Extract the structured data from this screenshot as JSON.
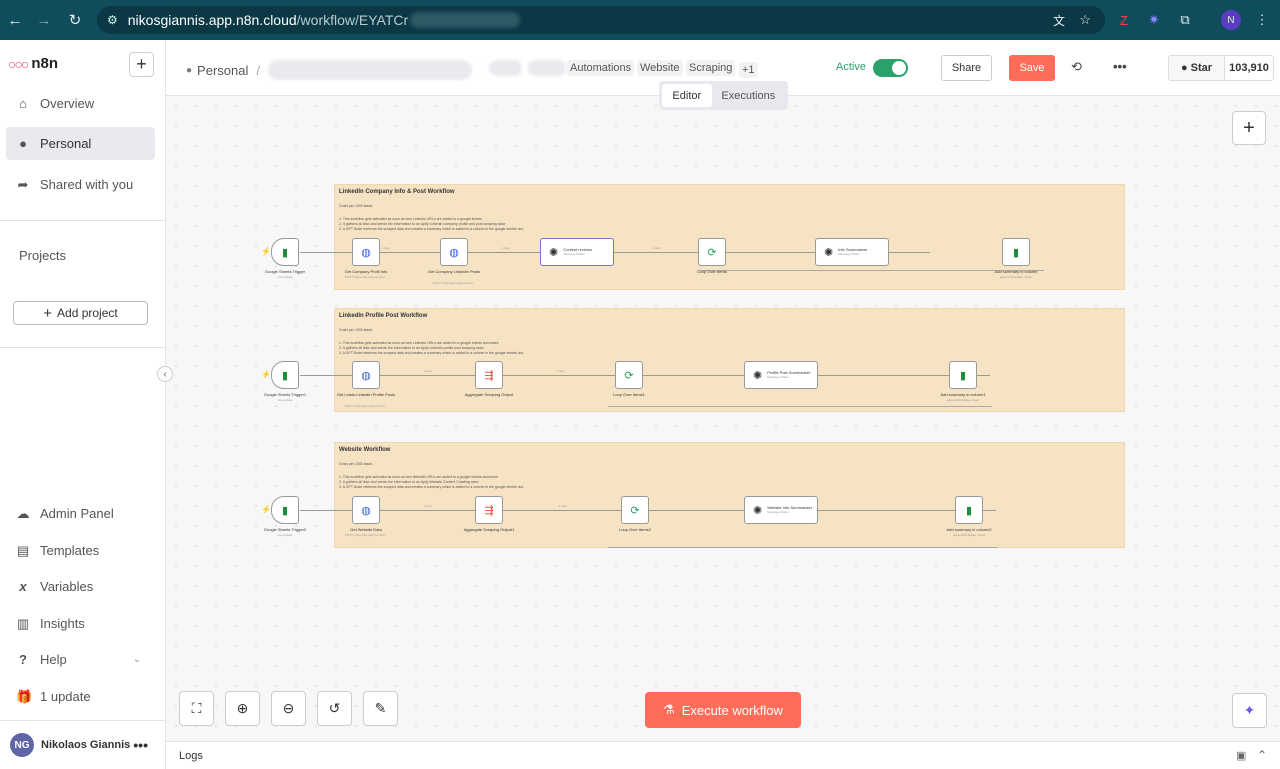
{
  "browser": {
    "url_host": "nikosgiannis.app.n8n.cloud",
    "url_path": "/workflow/EYATCr",
    "profile_initial": "N"
  },
  "sidebar": {
    "brand": "n8n",
    "items": [
      {
        "label": "Overview",
        "icon": "home-icon"
      },
      {
        "label": "Personal",
        "icon": "user-icon"
      },
      {
        "label": "Shared with you",
        "icon": "share-icon"
      }
    ],
    "projects_label": "Projects",
    "add_project": "Add project",
    "bottom_items": [
      {
        "label": "Admin Panel",
        "icon": "cloud-icon"
      },
      {
        "label": "Templates",
        "icon": "templates-icon"
      },
      {
        "label": "Variables",
        "icon": "variables-icon"
      },
      {
        "label": "Insights",
        "icon": "insights-icon"
      },
      {
        "label": "Help",
        "icon": "help-icon"
      },
      {
        "label": "1 update",
        "icon": "gift-icon"
      }
    ],
    "user": {
      "initials": "NG",
      "name": "Nikolaos Giannis"
    }
  },
  "header": {
    "breadcrumb": "Personal",
    "tags": [
      "Automations",
      "Website",
      "Scraping"
    ],
    "tags_more": "+1",
    "active_label": "Active",
    "active": true,
    "share": "Share",
    "save": "Save",
    "github_star": "Star",
    "github_count": "103,910",
    "tabs": [
      "Editor",
      "Executions"
    ]
  },
  "canvas": {
    "execute": "Execute workflow",
    "workflows": [
      {
        "title": "LinkedIn Company Info & Post Workflow",
        "cost": "Costs per 1000 leads:",
        "steps": [
          "1. This workflow gets activated as soon as new Linkedin URLs are added to a google sheets",
          "2. It gathers all links and sends the information to an Apify Linkedin company profile and post scraping actor",
          "3. A GPT Node retrieves the scraped data and creates a summary which is added to a column in the google sheets doc"
        ],
        "nodes": {
          "trigger": "Google Sheets Trigger",
          "trigger_sub": "row update",
          "n1": "Get Company Profil Info",
          "n1_sub": "POST: https://api.apify.com/v2...",
          "n2": "Get Company LinkedIn Posts",
          "n2_sub": "POST: https://api.apify.com/v2...",
          "n3": "Content revision",
          "n3_sub": "Message Model",
          "loop": "Loop Over Items",
          "n5": "Info Summarizer",
          "n5_sub": "Message Model",
          "out": "Add summary in column",
          "out_sub": "appendOrUpdate: sheet"
        },
        "edge_labels": [
          "1 item",
          "1 item",
          "1 item"
        ]
      },
      {
        "title": "LinkedIn Profile Post Workflow",
        "cost": "Costs per 1000 leads:",
        "steps": [
          "1. This workflow gets activated as soon as new LinkedIn URLs are added to a google sheets document",
          "2. It gathers all links and sends the information to an Apify LinkedIn profile post scraping actor",
          "3. A GPT Node retrieves the scraped data and creates a summary which is added to a column in the google sheets doc"
        ],
        "nodes": {
          "trigger": "Google Sheets Trigger1",
          "trigger_sub": "row update",
          "n1": "Get Leads LinkedIn Profile Posts",
          "n1_sub": "POST: https://api.apify.com/v2...",
          "n2": "Aggregate Scraping Output",
          "loop": "Loop Over Items1",
          "n5": "Profile Post Summarizer",
          "n5_sub": "Message Model",
          "out": "Add summary in column1",
          "out_sub": "appendOrUpdate: sheet"
        },
        "edge_labels": [
          "1 item",
          "1 item"
        ]
      },
      {
        "title": "Website Workflow",
        "cost": "Costs per 1000 leads:",
        "steps": [
          "1. This workflow gets activated as soon as new Website URLs are added to a google sheets document",
          "2. It gathers all links and sends the information to an Apify Website Content Crawling actor",
          "3. A GPT Node retrieves the scraped data and creates a summary which is added to a column in the google sheets doc"
        ],
        "nodes": {
          "trigger": "Google Sheets Trigger2",
          "trigger_sub": "row update",
          "n1": "Get Website Data",
          "n1_sub": "POST: https://api.apify.com/v2...",
          "n2": "Aggregate Scraping Output1",
          "loop": "Loop Over Items2",
          "n5": "Website Info Summarizer",
          "n5_sub": "Message Model",
          "out": "Add summary in column2",
          "out_sub": "appendOrUpdate: sheet"
        },
        "edge_labels": [
          "1 item",
          "1 item"
        ]
      }
    ]
  },
  "logs": {
    "label": "Logs"
  },
  "colors": {
    "browser_bar": "#0f4c5c",
    "accent": "#ff6d5a",
    "active": "#29a36a",
    "sticky": "#f6e3c4"
  }
}
